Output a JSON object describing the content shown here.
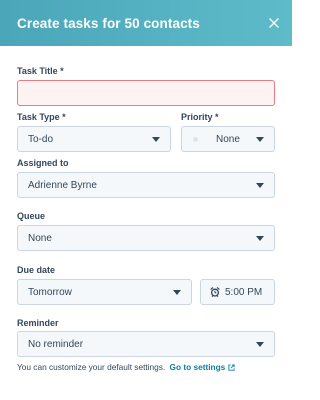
{
  "header": {
    "title": "Create tasks for 50 contacts"
  },
  "task_title": {
    "label": "Task Title *",
    "value": ""
  },
  "task_type": {
    "label": "Task Type *",
    "value": "To-do"
  },
  "priority": {
    "label": "Priority *",
    "value": "None"
  },
  "assigned_to": {
    "label": "Assigned to",
    "value": "Adrienne Byrne"
  },
  "queue": {
    "label": "Queue",
    "value": "None"
  },
  "due_date": {
    "label": "Due date",
    "date_value": "Tomorrow",
    "time_value": "5:00 PM"
  },
  "reminder": {
    "label": "Reminder",
    "value": "No reminder"
  },
  "footer": {
    "helper_text": "You can customize your default settings.",
    "link_text": "Go to settings"
  },
  "colors": {
    "header_start": "#4aa6b8",
    "header_end": "#5ebcc9",
    "field_bg": "#f5f8fa",
    "field_border": "#cbd6e2",
    "error_border": "#e87b84",
    "link": "#0b7ea1",
    "text": "#33475b"
  }
}
